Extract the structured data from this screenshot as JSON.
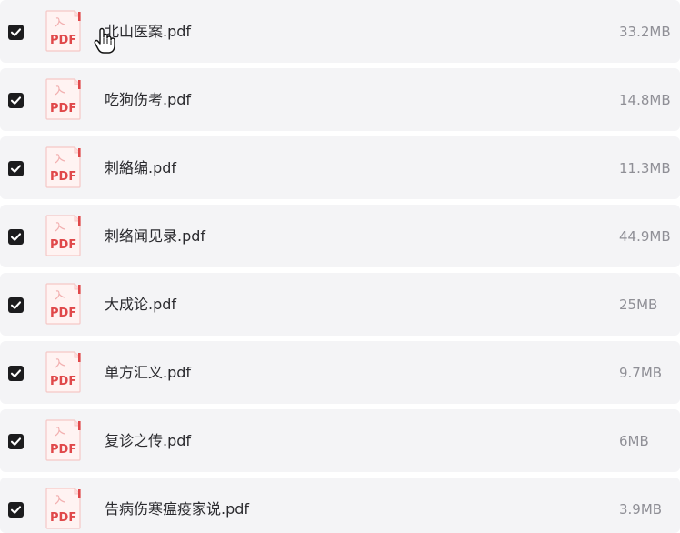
{
  "files": [
    {
      "name": "北山医案.pdf",
      "size": "33.2MB",
      "checked": true
    },
    {
      "name": "吃狗伤考.pdf",
      "size": "14.8MB",
      "checked": true
    },
    {
      "name": "刺絡编.pdf",
      "size": "11.3MB",
      "checked": true
    },
    {
      "name": "刺络闻见录.pdf",
      "size": "44.9MB",
      "checked": true
    },
    {
      "name": "大成论.pdf",
      "size": "25MB",
      "checked": true
    },
    {
      "name": "单方汇义.pdf",
      "size": "9.7MB",
      "checked": true
    },
    {
      "name": "复诊之传.pdf",
      "size": "6MB",
      "checked": true
    },
    {
      "name": "告病伤寒瘟疫家说.pdf",
      "size": "3.9MB",
      "checked": true
    }
  ],
  "icon": {
    "label": "PDF",
    "name": "pdf-file-icon"
  },
  "colors": {
    "row_bg": "#f4f4f6",
    "checkbox": "#1c1c1e",
    "pdf_red": "#e0484a",
    "pdf_tint": "#fde7e7",
    "name_text": "#2a2a2e",
    "size_text": "#8f8f96"
  }
}
